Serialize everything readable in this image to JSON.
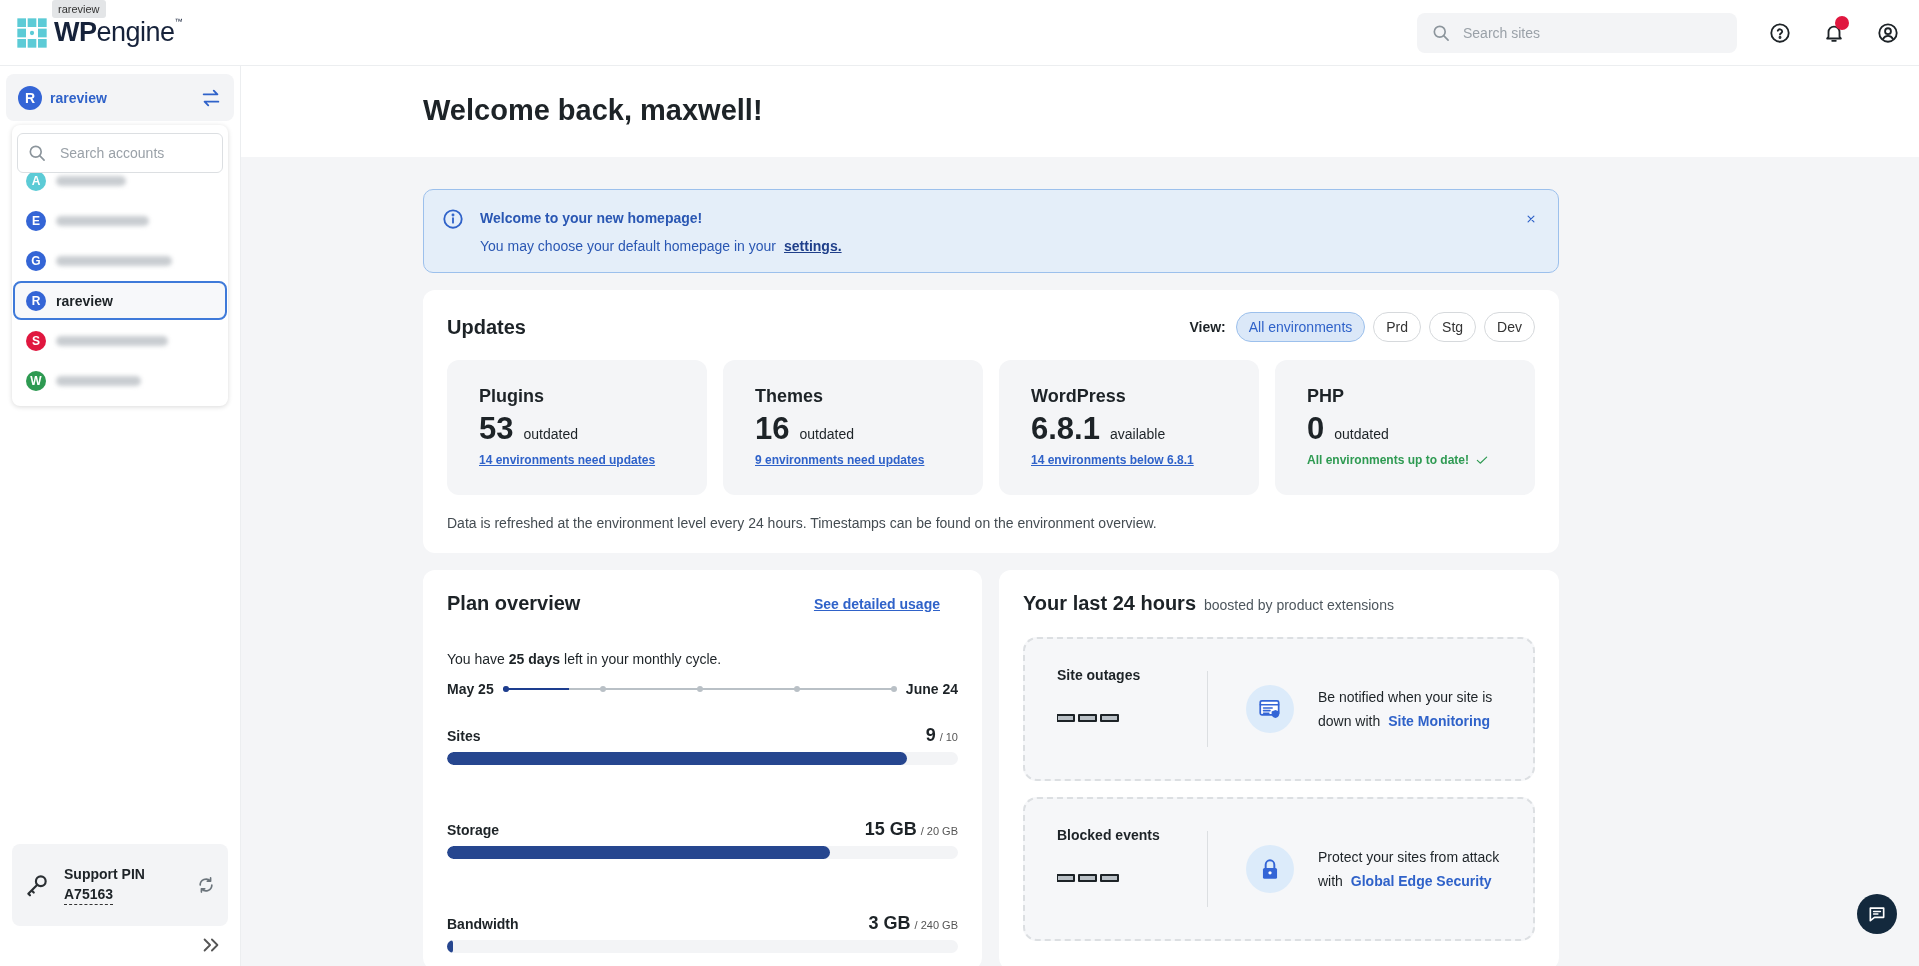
{
  "header": {
    "logo": {
      "bold": "WP",
      "rest": "engine",
      "mark": "™"
    },
    "tooltip": "rareview",
    "search": {
      "placeholder": "Search sites"
    },
    "notifications": {
      "unread": true
    }
  },
  "sidebar": {
    "account": {
      "letter": "R",
      "name": "rareview"
    },
    "account_search": {
      "placeholder": "Search accounts"
    },
    "accounts": [
      {
        "letter": "A",
        "color": "#5ccbd6",
        "selected": false
      },
      {
        "letter": "E",
        "color": "#3465d6",
        "selected": false
      },
      {
        "letter": "G",
        "color": "#3465d6",
        "selected": false
      },
      {
        "letter": "R",
        "color": "#3465d6",
        "name": "rareview",
        "selected": true
      },
      {
        "letter": "S",
        "color": "#e0173f",
        "selected": false
      },
      {
        "letter": "W",
        "color": "#2e9a52",
        "selected": false
      }
    ],
    "support_pin": {
      "label": "Support PIN",
      "value": "A75163"
    }
  },
  "main": {
    "greeting": "Welcome back, maxwell!",
    "banner": {
      "title": "Welcome to your new homepage!",
      "text": "You may choose your default homepage in your",
      "link": "settings."
    },
    "updates": {
      "title": "Updates",
      "view_label": "View:",
      "filters": [
        {
          "label": "All environments",
          "selected": true
        },
        {
          "label": "Prd",
          "selected": false
        },
        {
          "label": "Stg",
          "selected": false
        },
        {
          "label": "Dev",
          "selected": false
        }
      ],
      "cards": [
        {
          "title": "Plugins",
          "value": "53",
          "unit": "outdated",
          "kind": "link",
          "note": "14 environments need updates"
        },
        {
          "title": "Themes",
          "value": "16",
          "unit": "outdated",
          "kind": "link",
          "note": "9 environments need updates"
        },
        {
          "title": "WordPress",
          "value": "6.8.1",
          "unit": "available",
          "kind": "link",
          "note": "14 environments below 6.8.1"
        },
        {
          "title": "PHP",
          "value": "0",
          "unit": "outdated",
          "kind": "ok",
          "note": "All environments up to date!"
        }
      ],
      "footnote": "Data is refreshed at the environment level every 24 hours. Timestamps can be found on the environment overview."
    },
    "plan": {
      "title": "Plan overview",
      "link": "See detailed usage",
      "cycle": "You have **25 days** left in your monthly cycle.",
      "start": "May 25",
      "end": "June 24",
      "cycle_progress": {
        "level": 0.17
      },
      "meters": [
        {
          "label": "Sites",
          "used": "9",
          "limit": "/ 10",
          "level": 0.9
        },
        {
          "label": "Storage",
          "used": "15 GB",
          "limit": "/ 20 GB",
          "level": 0.75
        },
        {
          "label": "Bandwidth",
          "used": "3 GB",
          "limit": "/ 240 GB",
          "level": 0.0125
        }
      ]
    },
    "last24": {
      "title": "Your last 24 hours",
      "subtitle": "boosted by product extensions",
      "panels": [
        {
          "label": "Site outages",
          "kind": "monitor",
          "text": "Be notified when your site is down with",
          "link": "Site Monitoring"
        },
        {
          "label": "Blocked events",
          "kind": "lock",
          "text": "Protect your sites from attack with",
          "link": "Global Edge Security"
        }
      ]
    }
  }
}
